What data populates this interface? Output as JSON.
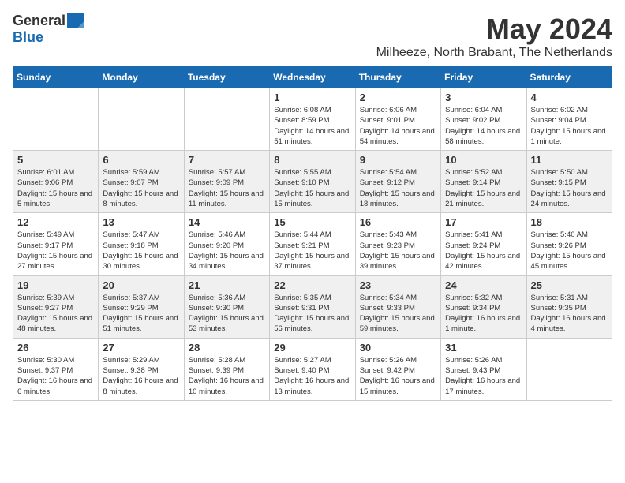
{
  "logo": {
    "general": "General",
    "blue": "Blue"
  },
  "title": {
    "month": "May 2024",
    "location": "Milheeze, North Brabant, The Netherlands"
  },
  "headers": [
    "Sunday",
    "Monday",
    "Tuesday",
    "Wednesday",
    "Thursday",
    "Friday",
    "Saturday"
  ],
  "weeks": [
    [
      {
        "day": "",
        "info": ""
      },
      {
        "day": "",
        "info": ""
      },
      {
        "day": "",
        "info": ""
      },
      {
        "day": "1",
        "info": "Sunrise: 6:08 AM\nSunset: 8:59 PM\nDaylight: 14 hours\nand 51 minutes."
      },
      {
        "day": "2",
        "info": "Sunrise: 6:06 AM\nSunset: 9:01 PM\nDaylight: 14 hours\nand 54 minutes."
      },
      {
        "day": "3",
        "info": "Sunrise: 6:04 AM\nSunset: 9:02 PM\nDaylight: 14 hours\nand 58 minutes."
      },
      {
        "day": "4",
        "info": "Sunrise: 6:02 AM\nSunset: 9:04 PM\nDaylight: 15 hours\nand 1 minute."
      }
    ],
    [
      {
        "day": "5",
        "info": "Sunrise: 6:01 AM\nSunset: 9:06 PM\nDaylight: 15 hours\nand 5 minutes."
      },
      {
        "day": "6",
        "info": "Sunrise: 5:59 AM\nSunset: 9:07 PM\nDaylight: 15 hours\nand 8 minutes."
      },
      {
        "day": "7",
        "info": "Sunrise: 5:57 AM\nSunset: 9:09 PM\nDaylight: 15 hours\nand 11 minutes."
      },
      {
        "day": "8",
        "info": "Sunrise: 5:55 AM\nSunset: 9:10 PM\nDaylight: 15 hours\nand 15 minutes."
      },
      {
        "day": "9",
        "info": "Sunrise: 5:54 AM\nSunset: 9:12 PM\nDaylight: 15 hours\nand 18 minutes."
      },
      {
        "day": "10",
        "info": "Sunrise: 5:52 AM\nSunset: 9:14 PM\nDaylight: 15 hours\nand 21 minutes."
      },
      {
        "day": "11",
        "info": "Sunrise: 5:50 AM\nSunset: 9:15 PM\nDaylight: 15 hours\nand 24 minutes."
      }
    ],
    [
      {
        "day": "12",
        "info": "Sunrise: 5:49 AM\nSunset: 9:17 PM\nDaylight: 15 hours\nand 27 minutes."
      },
      {
        "day": "13",
        "info": "Sunrise: 5:47 AM\nSunset: 9:18 PM\nDaylight: 15 hours\nand 30 minutes."
      },
      {
        "day": "14",
        "info": "Sunrise: 5:46 AM\nSunset: 9:20 PM\nDaylight: 15 hours\nand 34 minutes."
      },
      {
        "day": "15",
        "info": "Sunrise: 5:44 AM\nSunset: 9:21 PM\nDaylight: 15 hours\nand 37 minutes."
      },
      {
        "day": "16",
        "info": "Sunrise: 5:43 AM\nSunset: 9:23 PM\nDaylight: 15 hours\nand 39 minutes."
      },
      {
        "day": "17",
        "info": "Sunrise: 5:41 AM\nSunset: 9:24 PM\nDaylight: 15 hours\nand 42 minutes."
      },
      {
        "day": "18",
        "info": "Sunrise: 5:40 AM\nSunset: 9:26 PM\nDaylight: 15 hours\nand 45 minutes."
      }
    ],
    [
      {
        "day": "19",
        "info": "Sunrise: 5:39 AM\nSunset: 9:27 PM\nDaylight: 15 hours\nand 48 minutes."
      },
      {
        "day": "20",
        "info": "Sunrise: 5:37 AM\nSunset: 9:29 PM\nDaylight: 15 hours\nand 51 minutes."
      },
      {
        "day": "21",
        "info": "Sunrise: 5:36 AM\nSunset: 9:30 PM\nDaylight: 15 hours\nand 53 minutes."
      },
      {
        "day": "22",
        "info": "Sunrise: 5:35 AM\nSunset: 9:31 PM\nDaylight: 15 hours\nand 56 minutes."
      },
      {
        "day": "23",
        "info": "Sunrise: 5:34 AM\nSunset: 9:33 PM\nDaylight: 15 hours\nand 59 minutes."
      },
      {
        "day": "24",
        "info": "Sunrise: 5:32 AM\nSunset: 9:34 PM\nDaylight: 16 hours\nand 1 minute."
      },
      {
        "day": "25",
        "info": "Sunrise: 5:31 AM\nSunset: 9:35 PM\nDaylight: 16 hours\nand 4 minutes."
      }
    ],
    [
      {
        "day": "26",
        "info": "Sunrise: 5:30 AM\nSunset: 9:37 PM\nDaylight: 16 hours\nand 6 minutes."
      },
      {
        "day": "27",
        "info": "Sunrise: 5:29 AM\nSunset: 9:38 PM\nDaylight: 16 hours\nand 8 minutes."
      },
      {
        "day": "28",
        "info": "Sunrise: 5:28 AM\nSunset: 9:39 PM\nDaylight: 16 hours\nand 10 minutes."
      },
      {
        "day": "29",
        "info": "Sunrise: 5:27 AM\nSunset: 9:40 PM\nDaylight: 16 hours\nand 13 minutes."
      },
      {
        "day": "30",
        "info": "Sunrise: 5:26 AM\nSunset: 9:42 PM\nDaylight: 16 hours\nand 15 minutes."
      },
      {
        "day": "31",
        "info": "Sunrise: 5:26 AM\nSunset: 9:43 PM\nDaylight: 16 hours\nand 17 minutes."
      },
      {
        "day": "",
        "info": ""
      }
    ]
  ]
}
